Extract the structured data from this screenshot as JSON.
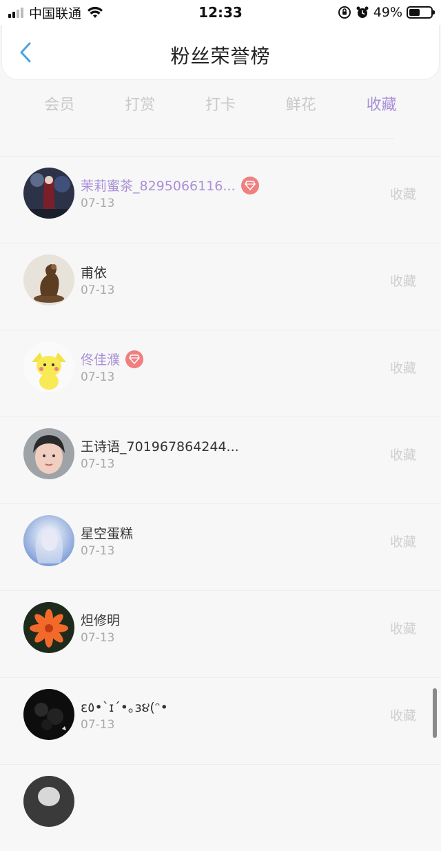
{
  "status_bar": {
    "carrier": "中国联通",
    "time": "12:33",
    "battery": "49%",
    "battery_level": 0.49
  },
  "header": {
    "title": "粉丝荣誉榜",
    "back_icon": "chevron-left-icon"
  },
  "tabs": [
    {
      "label": "会员",
      "active": false
    },
    {
      "label": "打赏",
      "active": false
    },
    {
      "label": "打卡",
      "active": false
    },
    {
      "label": "鲜花",
      "active": false
    },
    {
      "label": "收藏",
      "active": true
    }
  ],
  "colors": {
    "accent": "#a98fd8",
    "badge": "#f07f7f",
    "muted": "#a9a9a9",
    "action": "#cfcfcf"
  },
  "list": [
    {
      "name": "茉莉蜜茶_8295066116...",
      "date": "07-13",
      "action": "收藏",
      "vip": true
    },
    {
      "name": "甫依",
      "date": "07-13",
      "action": "收藏",
      "vip": false
    },
    {
      "name": "佟佳濮",
      "date": "07-13",
      "action": "收藏",
      "vip": true
    },
    {
      "name": "王诗语_701967864244...",
      "date": "07-13",
      "action": "收藏",
      "vip": false
    },
    {
      "name": "星空蛋糕",
      "date": "07-13",
      "action": "收藏",
      "vip": false
    },
    {
      "name": "炟修明",
      "date": "07-13",
      "action": "收藏",
      "vip": false
    },
    {
      "name": "ε٥•`ɪ´•｡з૪(ᵔ•",
      "date": "07-13",
      "action": "收藏",
      "vip": false
    }
  ]
}
